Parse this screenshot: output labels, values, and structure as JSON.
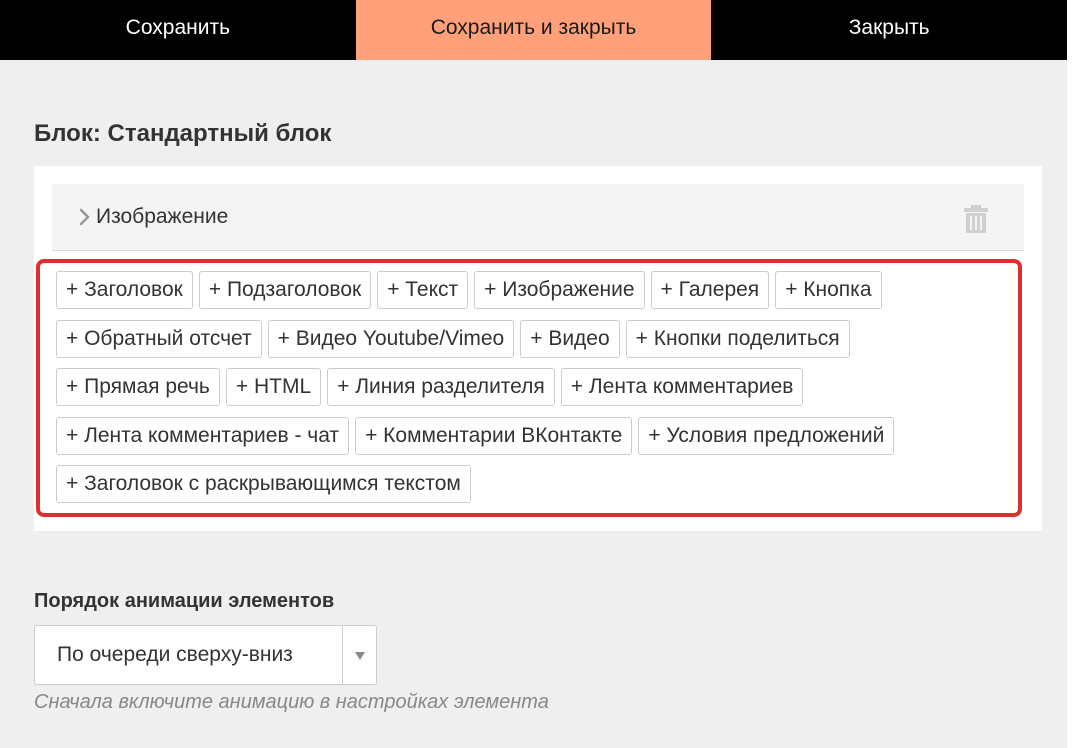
{
  "topbar": {
    "save_label": "Сохранить",
    "save_close_label": "Сохранить и закрыть",
    "close_label": "Закрыть"
  },
  "block": {
    "title": "Блок: Стандартный блок",
    "accordion_label": "Изображение",
    "add_element_rows": [
      [
        "+ Заголовок",
        "+ Подзаголовок",
        "+ Текст",
        "+ Изображение",
        "+ Галерея",
        "+ Кнопка"
      ],
      [
        "+ Обратный отсчет",
        "+ Видео Youtube/Vimeo",
        "+ Видео",
        "+ Кнопки поделиться"
      ],
      [
        "+ Прямая речь",
        "+ HTML",
        "+ Линия разделителя",
        "+ Лента комментариев"
      ],
      [
        "+ Лента комментариев - чат",
        "+ Комментарии ВКонтакте",
        "+ Условия предложений"
      ],
      [
        "+ Заголовок с раскрывающимся текстом"
      ]
    ]
  },
  "animation": {
    "label": "Порядок анимации элементов",
    "selected_option": "По очереди сверху-вниз",
    "hint": "Сначала включите анимацию в настройках элемента"
  },
  "icons": {
    "accordion_toggle": "chevron-right-icon",
    "delete": "trash-icon",
    "select_toggle": "caret-down-icon"
  },
  "colors": {
    "topbar_bg": "#000000",
    "primary_button_bg": "#ffa07a",
    "highlight_border": "#e02e2e",
    "page_bg": "#efefef"
  }
}
